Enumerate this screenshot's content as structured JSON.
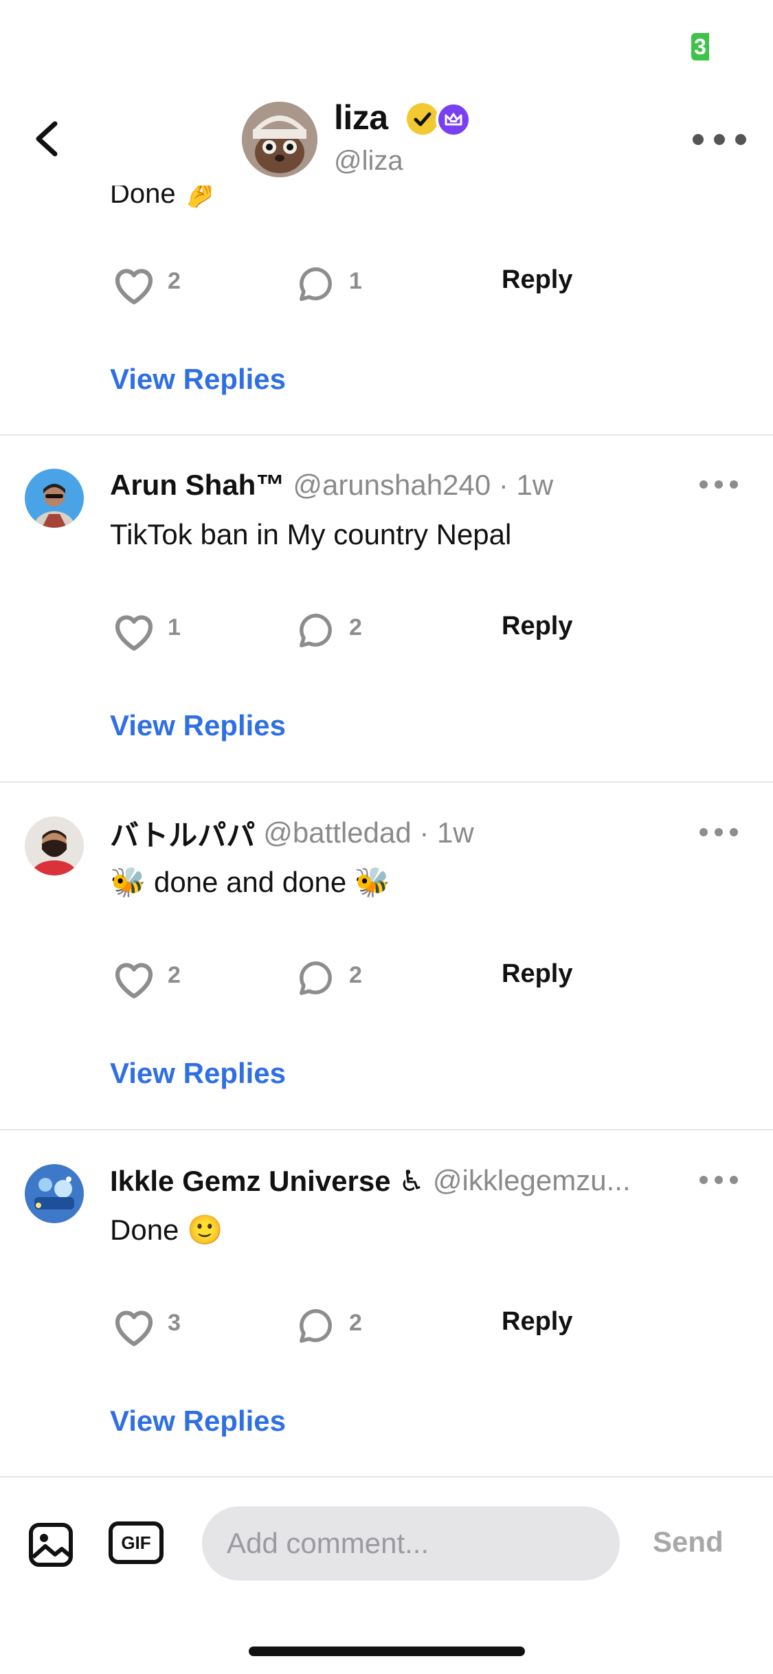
{
  "status": {
    "badge_text": "3"
  },
  "header": {
    "name": "liza",
    "handle": "@liza"
  },
  "partial_comment": {
    "text": "Done 🤌",
    "likes": "2",
    "replies": "1",
    "reply_label": "Reply",
    "view_replies_label": "View Replies"
  },
  "comments": [
    {
      "name": "Arun Shah™",
      "handle_time": "@arunshah240 · 1w",
      "text": "TikTok ban in My country Nepal",
      "likes": "1",
      "replies": "2",
      "reply_label": "Reply",
      "view_replies_label": "View Replies"
    },
    {
      "name": "バトルパパ",
      "handle_time": "@battledad · 1w",
      "text": "🐝  done and done 🐝",
      "likes": "2",
      "replies": "2",
      "reply_label": "Reply",
      "view_replies_label": "View Replies"
    },
    {
      "name": "Ikkle Gemz Universe ♿",
      "handle_time": "@ikklegemzu...",
      "text": "Done 🙂",
      "likes": "3",
      "replies": "2",
      "reply_label": "Reply",
      "view_replies_label": "View Replies"
    }
  ],
  "composer": {
    "gif_label": "GIF",
    "placeholder": "Add comment...",
    "send_label": "Send"
  },
  "colors": {
    "link_blue": "#2f6fe4",
    "count_gray": "#8d8d8d",
    "verified_yellow": "#f3c932",
    "crown_purple": "#7a3ff0",
    "status_green": "#3ec24a"
  },
  "icons": [
    "back-chevron-icon",
    "more-dots-icon",
    "verified-check-icon",
    "crown-icon",
    "heart-icon",
    "speech-bubble-icon",
    "image-icon",
    "gif-icon"
  ]
}
